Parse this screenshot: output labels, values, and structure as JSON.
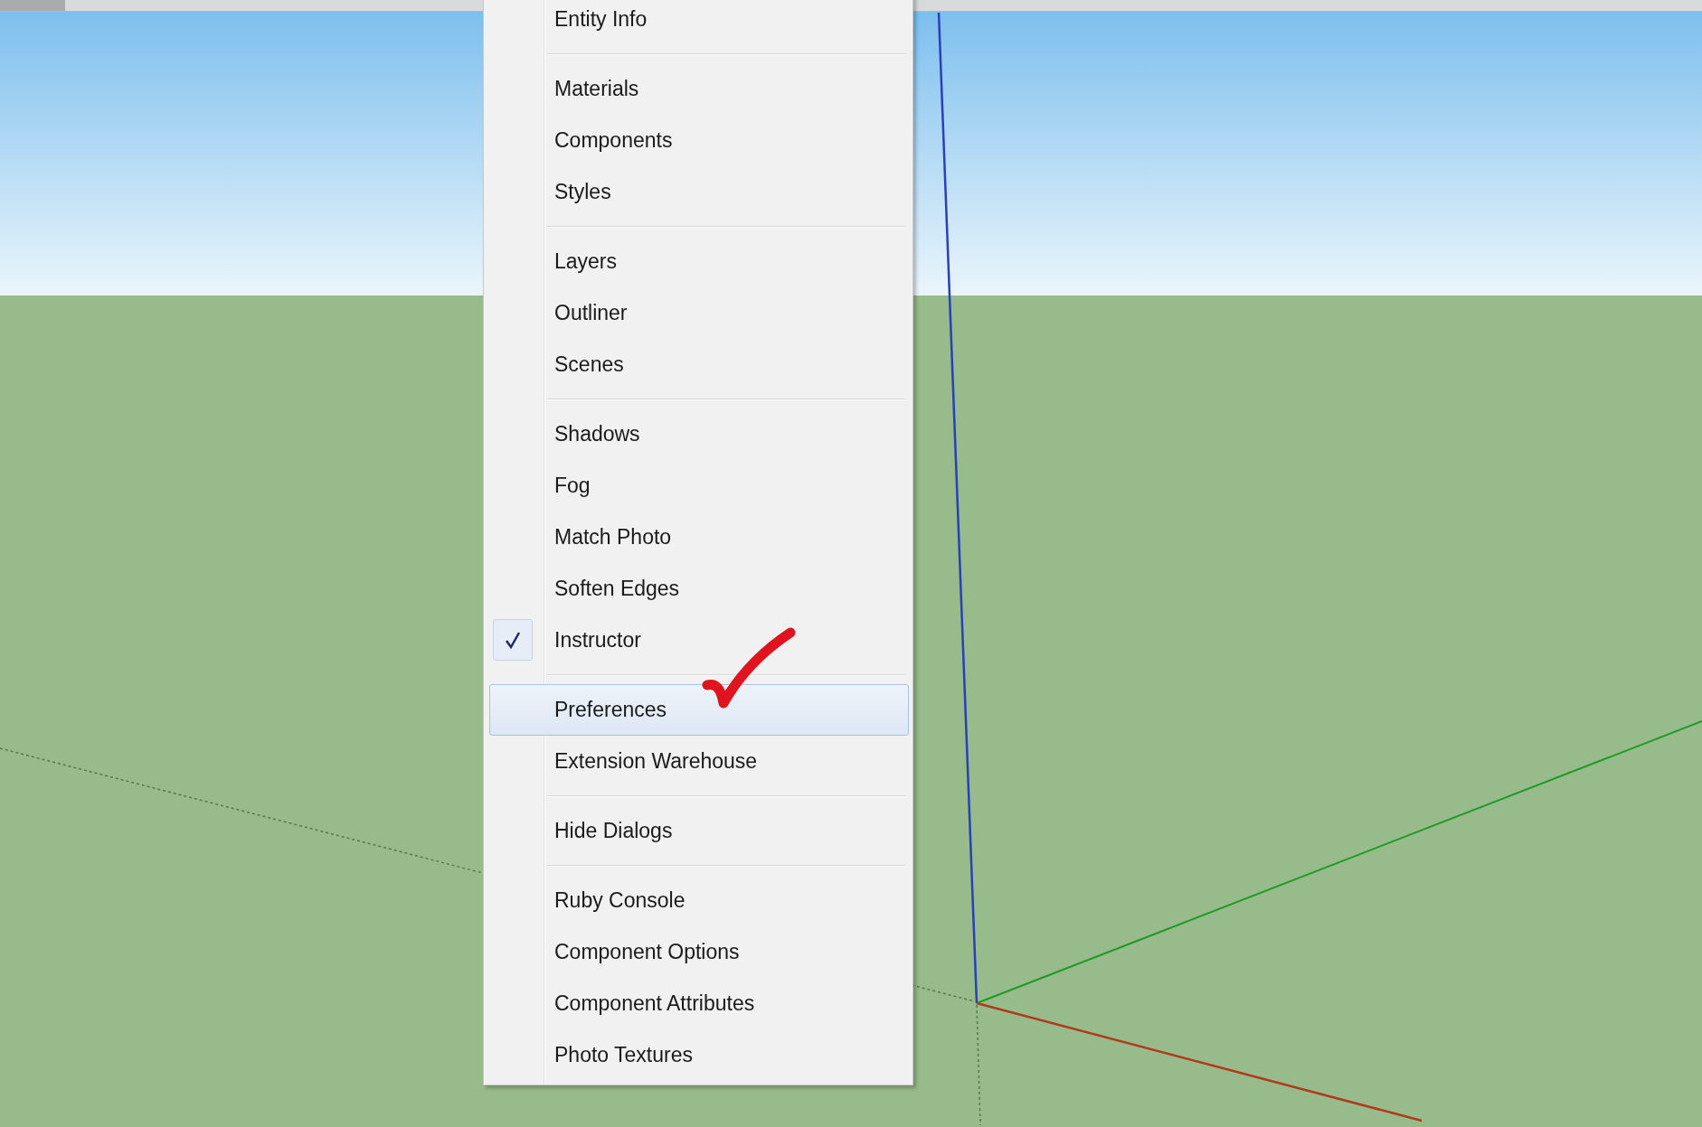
{
  "menu": {
    "items": [
      {
        "kind": "item",
        "label": "Entity Info",
        "checked": false,
        "highlighted": false
      },
      {
        "kind": "separator"
      },
      {
        "kind": "item",
        "label": "Materials",
        "checked": false,
        "highlighted": false
      },
      {
        "kind": "item",
        "label": "Components",
        "checked": false,
        "highlighted": false
      },
      {
        "kind": "item",
        "label": "Styles",
        "checked": false,
        "highlighted": false
      },
      {
        "kind": "separator"
      },
      {
        "kind": "item",
        "label": "Layers",
        "checked": false,
        "highlighted": false
      },
      {
        "kind": "item",
        "label": "Outliner",
        "checked": false,
        "highlighted": false
      },
      {
        "kind": "item",
        "label": "Scenes",
        "checked": false,
        "highlighted": false
      },
      {
        "kind": "separator"
      },
      {
        "kind": "item",
        "label": "Shadows",
        "checked": false,
        "highlighted": false
      },
      {
        "kind": "item",
        "label": "Fog",
        "checked": false,
        "highlighted": false
      },
      {
        "kind": "item",
        "label": "Match Photo",
        "checked": false,
        "highlighted": false
      },
      {
        "kind": "item",
        "label": "Soften Edges",
        "checked": false,
        "highlighted": false
      },
      {
        "kind": "item",
        "label": "Instructor",
        "checked": true,
        "highlighted": false
      },
      {
        "kind": "separator"
      },
      {
        "kind": "item",
        "label": "Preferences",
        "checked": false,
        "highlighted": true
      },
      {
        "kind": "item",
        "label": "Extension Warehouse",
        "checked": false,
        "highlighted": false
      },
      {
        "kind": "separator"
      },
      {
        "kind": "item",
        "label": "Hide Dialogs",
        "checked": false,
        "highlighted": false
      },
      {
        "kind": "separator"
      },
      {
        "kind": "item",
        "label": "Ruby Console",
        "checked": false,
        "highlighted": false
      },
      {
        "kind": "item",
        "label": "Component Options",
        "checked": false,
        "highlighted": false
      },
      {
        "kind": "item",
        "label": "Component Attributes",
        "checked": false,
        "highlighted": false
      },
      {
        "kind": "item",
        "label": "Photo Textures",
        "checked": false,
        "highlighted": false
      }
    ]
  }
}
